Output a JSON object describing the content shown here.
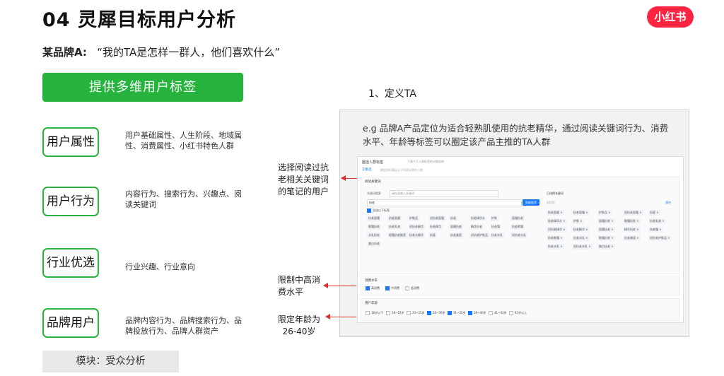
{
  "slide": {
    "title": "04 灵犀目标用户分析",
    "logo": "小红书",
    "subtitle_brand": "某品牌A:",
    "subtitle_quote": "“我的TA是怎样一群人，他们喜欢什么”",
    "main_button": "提供多维用户标签",
    "module_label": "模块：受众分析"
  },
  "tags": [
    {
      "label": "用户属性",
      "desc": "用户基础属性、人生阶段、地域属性、消费属性、小红书特色人群"
    },
    {
      "label": "用户行为",
      "desc": "内容行为、搜索行为、兴趣点、阅读关键词"
    },
    {
      "label": "行业优选",
      "desc": "行业兴趣、行业意向"
    },
    {
      "label": "品牌用户",
      "desc": "品牌内容行为、品牌搜索行为、品牌投放行为、品牌人群资产"
    }
  ],
  "right": {
    "step": "1、定义TA",
    "example": "e.g 品牌A产品定位为适合轻熟肌使用的抗老精华，通过阅读关键词行为、消费水平、年龄等标签可以圈定该产品主推的TA人群"
  },
  "annotations": [
    {
      "text": "选择阅读过抗老相关关键词的笔记的用户"
    },
    {
      "text": "限制中高消费水平"
    },
    {
      "text": "限定年龄为26-40岁"
    }
  ],
  "screenshot": {
    "header": "圈选人群标签",
    "header_hint": "下载千万人群标签的详细说明",
    "tab": "交集选",
    "tab_hint": "圈定同时满足以下所选标签的人群",
    "keyword_section": "阅读关键词",
    "keyword_label": "关键词搜索",
    "keyword_placeholder": "请在此输入关键词",
    "keyword_value": "抗老",
    "search_button": "智能推荐",
    "select_all": "全选以下标签",
    "selected_title": "已选择关键词",
    "selected_count": "20/20",
    "clear": "清空",
    "keyword_chips": [
      "抗老面霜",
      "抗老面膜",
      "护肤品",
      "初抗老面霜",
      "抗衰",
      "抗老精华水",
      "护肤",
      "面霜抗老",
      "眼霜抗老",
      "抗老乳液",
      "初抗老精华",
      "抗老精华",
      "面膜抗老",
      "精华抗老",
      "抗老霜",
      "抗老眼霜",
      "水乳抗老",
      "眼霜抗老推荐",
      "抗老水精华",
      "抗衰",
      "抗老美容",
      "初抗老护肤品",
      "抗老水乳",
      "初抗老水乳",
      "美白抗老"
    ],
    "selected_chips": [
      "抗老面膜",
      "抗老面霜",
      "护肤品",
      "初抗老面霜",
      "抗衰",
      "抗老精华水",
      "护肤",
      "面霜抗老",
      "眼霜抗老",
      "抗老乳液",
      "初抗老精华",
      "抗老精华",
      "面膜抗老",
      "精华抗老",
      "抗老霜",
      "抗老眼霜",
      "抗老水乳",
      "眼霜抗老",
      "抗老美容",
      "初抗老护肤品",
      "抗老水乳",
      "初抗老水乳",
      "美白抗老"
    ],
    "consumption_section": "消费水平",
    "consumption_options": [
      {
        "label": "高消费",
        "checked": true
      },
      {
        "label": "中消费",
        "checked": true
      },
      {
        "label": "低消费",
        "checked": false
      }
    ],
    "age_section": "用户年龄",
    "age_options": [
      {
        "label": "18岁以下",
        "checked": false
      },
      {
        "label": "18~22岁",
        "checked": false
      },
      {
        "label": "23~25岁",
        "checked": false
      },
      {
        "label": "26~30岁",
        "checked": true
      },
      {
        "label": "31~35岁",
        "checked": true
      },
      {
        "label": "36~40岁",
        "checked": true
      },
      {
        "label": "41~43岁",
        "checked": false
      },
      {
        "label": "43岁以上",
        "checked": false
      }
    ]
  }
}
